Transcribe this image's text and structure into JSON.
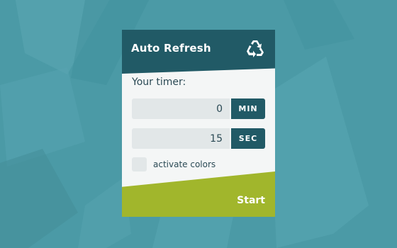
{
  "app": {
    "title": "Auto Refresh",
    "icon": "recycle-icon"
  },
  "timer": {
    "label": "Your timer:",
    "minutes": {
      "value": "0",
      "unit": "MIN"
    },
    "seconds": {
      "value": "15",
      "unit": "SEC"
    }
  },
  "options": {
    "activate_colors": {
      "label": "activate colors",
      "checked": false
    }
  },
  "actions": {
    "start_label": "Start"
  },
  "colors": {
    "background": "#4b9aa6",
    "header": "#215a66",
    "accent": "#a1b62c",
    "field": "#e2e7e8",
    "card": "#f4f6f6"
  }
}
